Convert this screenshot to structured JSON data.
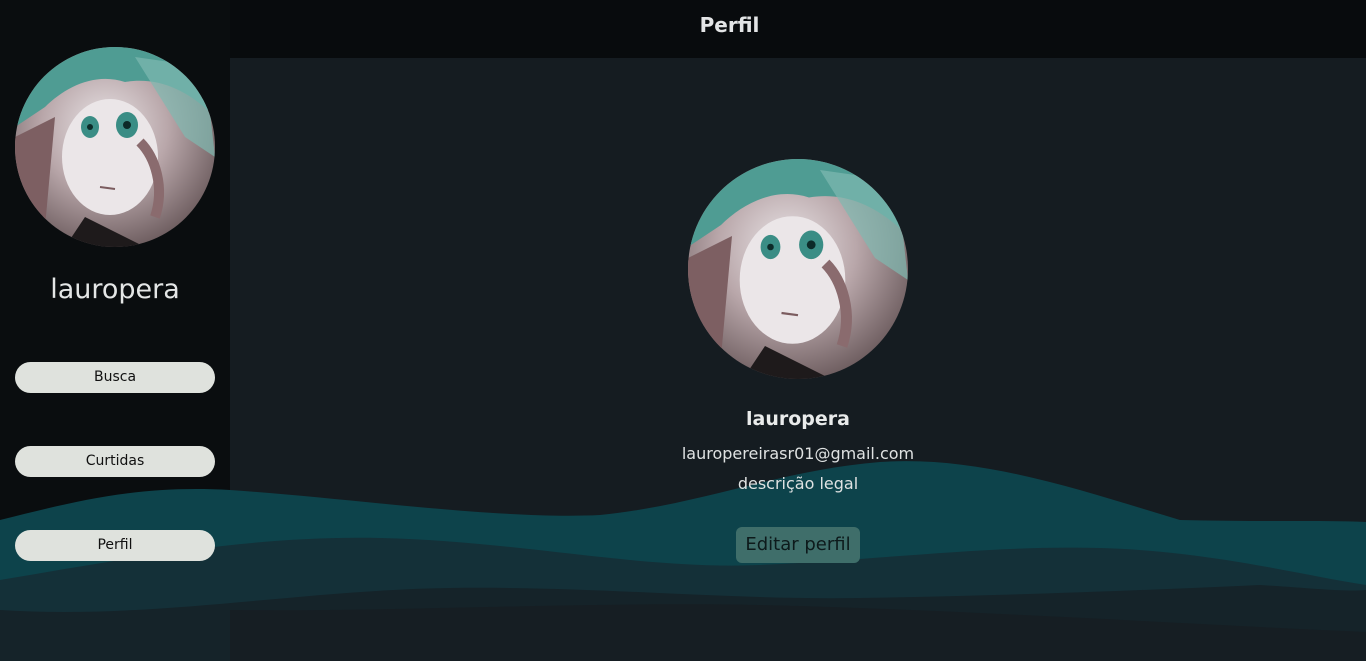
{
  "header": {
    "title": "Perfil"
  },
  "sidebar": {
    "avatar_icon": "user-avatar-image",
    "username": "lauropera",
    "nav": [
      {
        "label": "Busca"
      },
      {
        "label": "Curtidas"
      },
      {
        "label": "Perfil"
      }
    ]
  },
  "profile": {
    "avatar_icon": "user-avatar-image",
    "username": "lauropera",
    "email": "lauropereirasr01@gmail.com",
    "description": "descrição legal",
    "edit_label": "Editar perfil"
  },
  "colors": {
    "background": "#090c0e",
    "main_panel": "#151c21",
    "wave_teal": "#0d434b",
    "button_light": "#dfe2dd",
    "edit_button": "#3f6e6a"
  }
}
